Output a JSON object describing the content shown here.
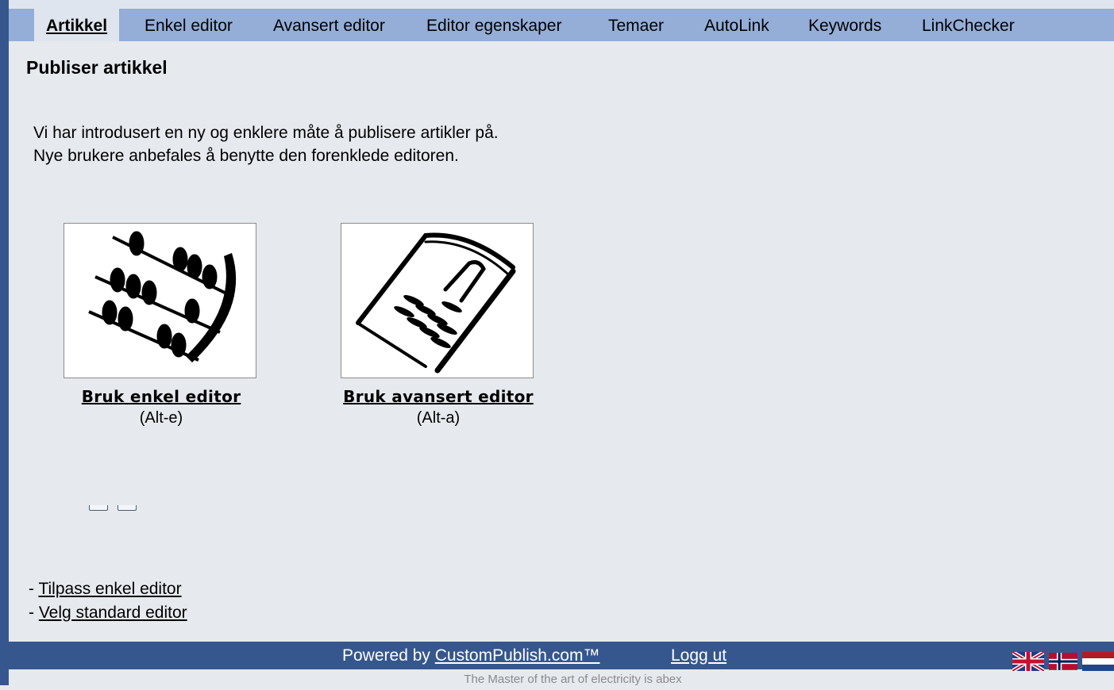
{
  "tabs": [
    {
      "label": "Artikkel",
      "active": true
    },
    {
      "label": "Enkel editor"
    },
    {
      "label": "Avansert editor"
    },
    {
      "label": "Editor egenskaper"
    },
    {
      "label": "Temaer"
    },
    {
      "label": "AutoLink"
    },
    {
      "label": "Keywords"
    },
    {
      "label": "LinkChecker"
    }
  ],
  "page": {
    "title": "Publiser artikkel",
    "intro_line1": "Vi har introdusert en ny og enklere måte å publisere artikler på.",
    "intro_line2": "Nye brukere anbefales å benytte den forenklede editoren."
  },
  "editors": {
    "simple": {
      "label": "Bruk enkel editor",
      "hotkey": "(Alt-e)",
      "icon": "abacus-icon"
    },
    "advanced": {
      "label": "Bruk avansert editor",
      "hotkey": "(Alt-a)",
      "icon": "notepad-pen-icon"
    }
  },
  "options": {
    "prefix": "- ",
    "customize_label": "Tilpass enkel editor",
    "default_label": "Velg standard editor"
  },
  "footer": {
    "powered_prefix": "Powered by ",
    "brand": "CustomPublish.com™",
    "logout": "Logg ut",
    "tagline": "The Master of the art of electricity is abex",
    "flags": [
      "uk-flag-icon",
      "norway-flag-icon",
      "netherlands-flag-icon"
    ]
  },
  "colors": {
    "nav_blue": "#94aed8",
    "footer_blue": "#36568e",
    "page_bg": "#e6eaee"
  }
}
